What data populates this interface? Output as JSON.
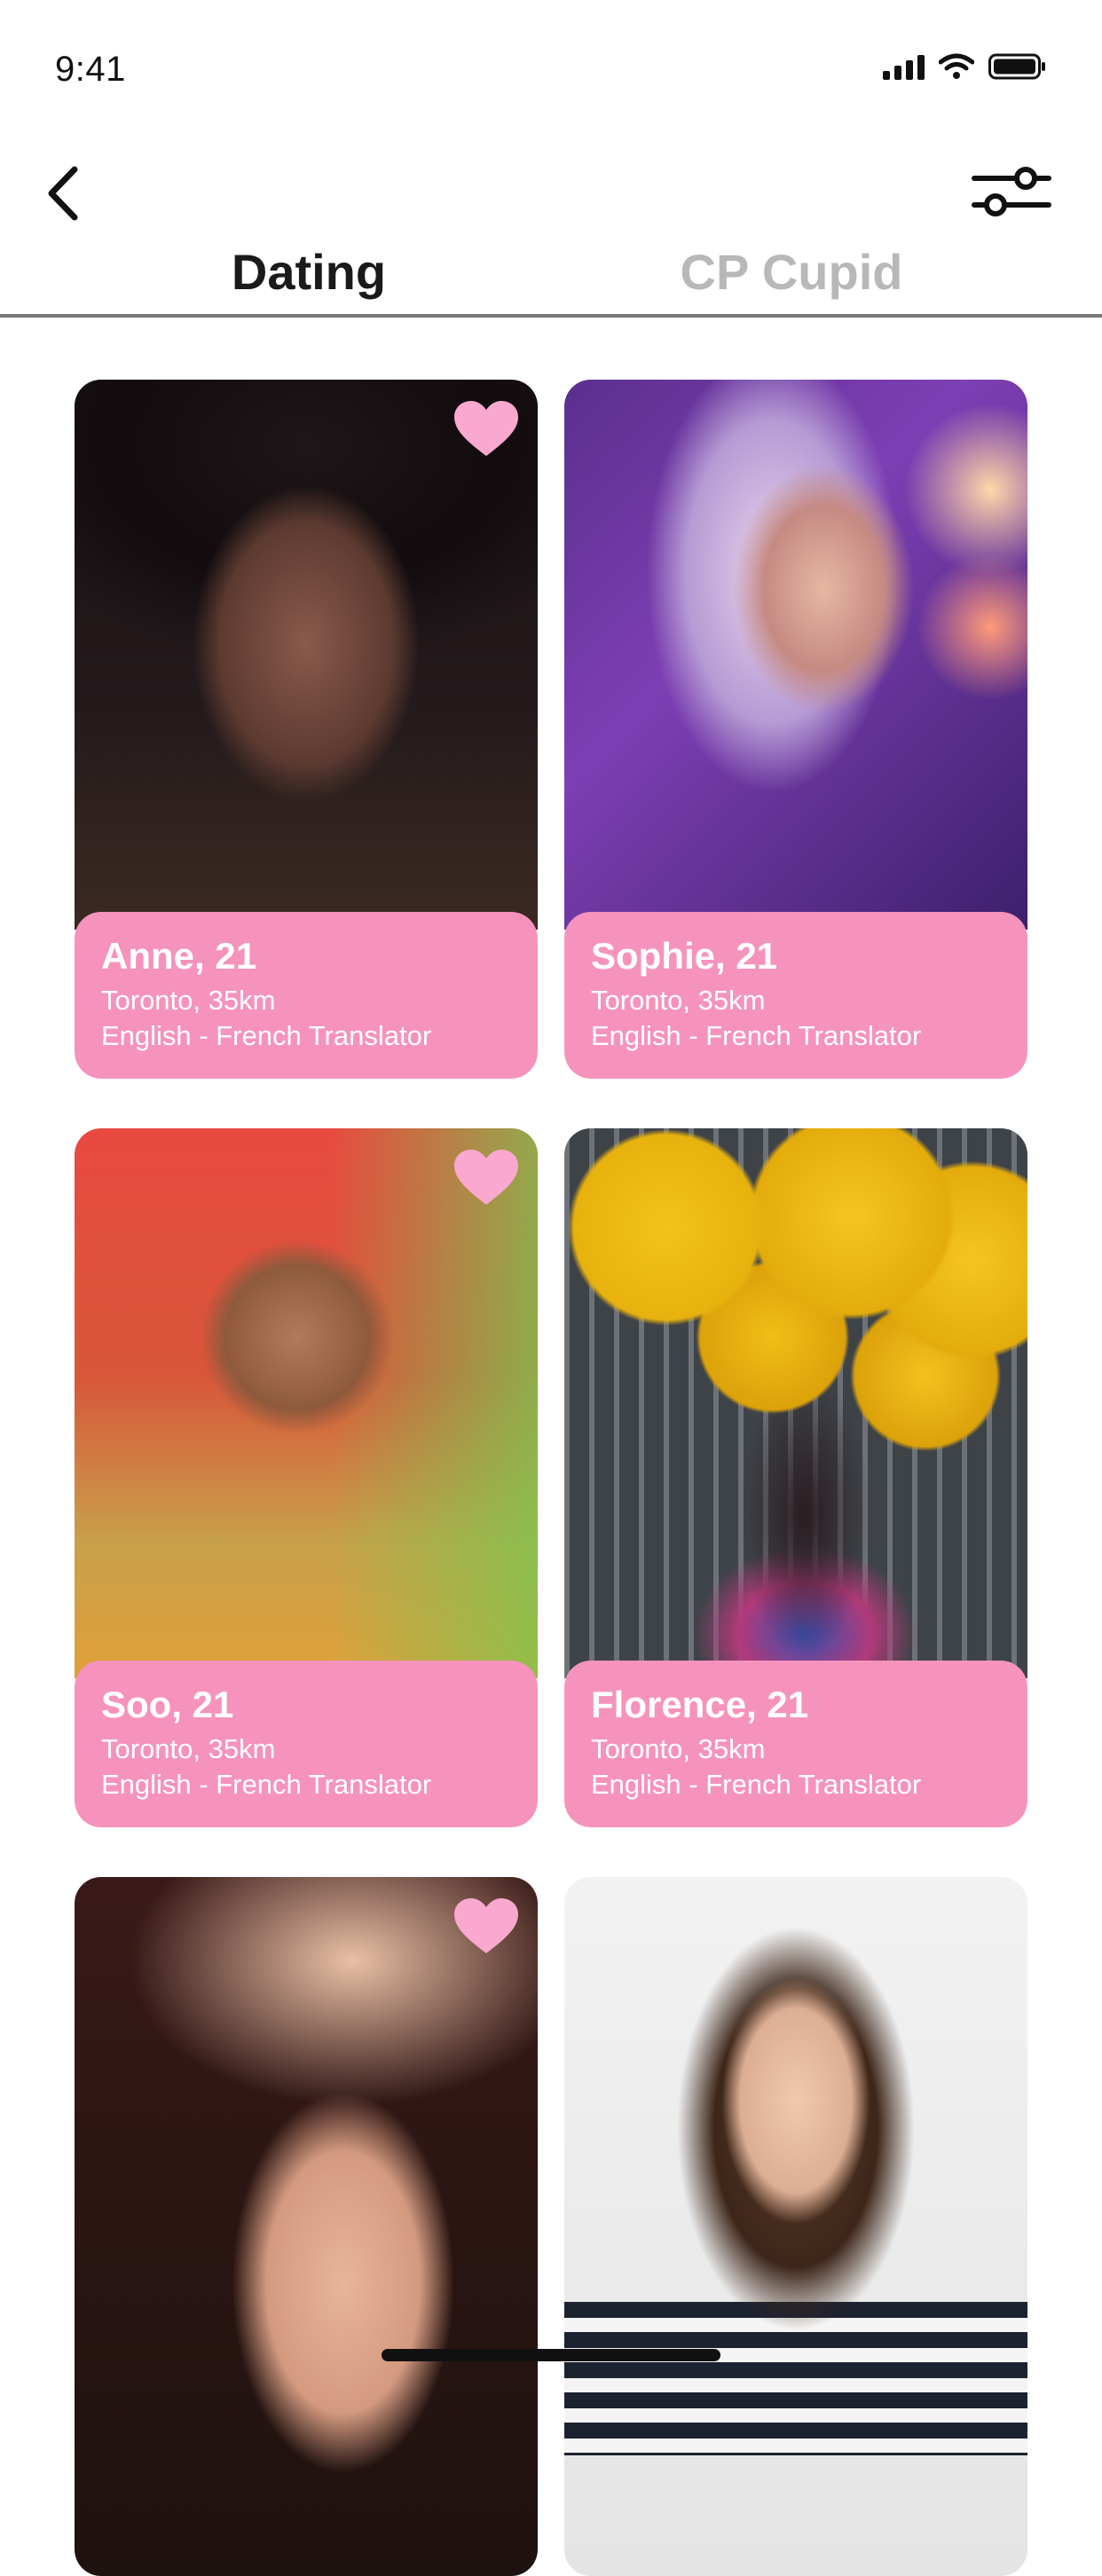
{
  "status_bar": {
    "time": "9:41",
    "icons": [
      "cellular-icon",
      "wifi-icon",
      "battery-icon"
    ]
  },
  "header": {
    "back_icon": "chevron-left-icon",
    "filter_icon": "sliders-icon"
  },
  "tabs": [
    {
      "label": "Dating",
      "active": true
    },
    {
      "label": "CP Cupid",
      "active": false
    }
  ],
  "colors": {
    "card_info_bg": "#f593bd",
    "heart": "#f9a8cf",
    "active_tab": "#1a1a1a",
    "inactive_tab": "#b8b8b8"
  },
  "profiles": [
    {
      "name": "Anne, 21",
      "location": "Toronto, 35km",
      "job": "English - French Translator",
      "favorited": true
    },
    {
      "name": "Sophie, 21",
      "location": "Toronto, 35km",
      "job": "English - French Translator",
      "favorited": false
    },
    {
      "name": "Soo, 21",
      "location": "Toronto, 35km",
      "job": "English - French Translator",
      "favorited": true
    },
    {
      "name": "Florence, 21",
      "location": "Toronto, 35km",
      "job": "English - French Translator",
      "favorited": false
    },
    {
      "favorited": true
    },
    {
      "favorited": false
    }
  ]
}
